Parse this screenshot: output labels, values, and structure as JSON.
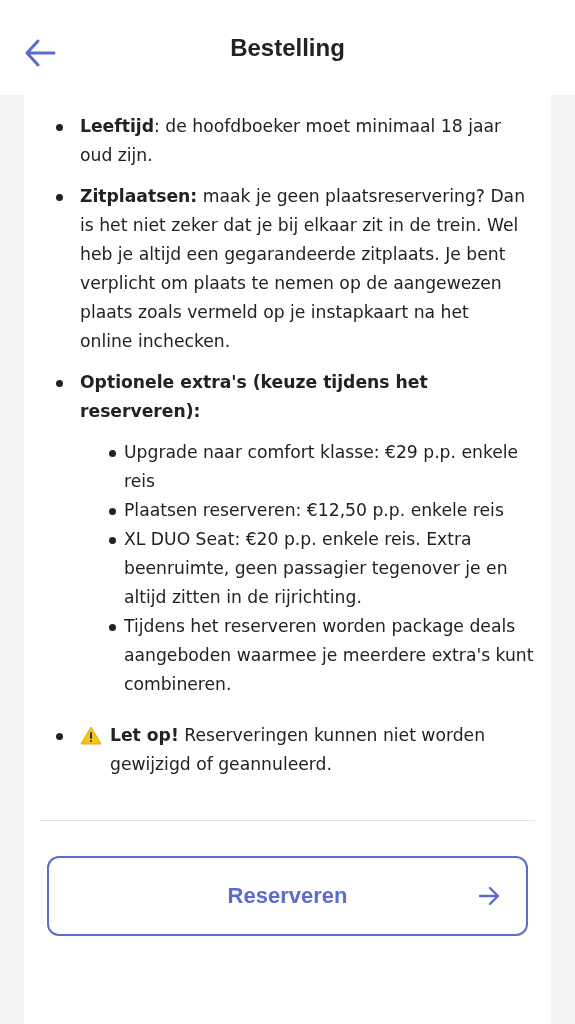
{
  "header": {
    "title": "Bestelling"
  },
  "items": [
    {
      "kind": "text",
      "text": "**Leeftijd**: de hoofdboeker moet minimaal 18 jaar oud zijn."
    },
    {
      "kind": "text",
      "text": "**Zitplaatsen:** maak je geen plaatsreservering? Dan is het niet zeker dat je bij elkaar zit in de trein. Wel heb je altijd een gegarandeerde zitplaats. Je bent verplicht om plaats te nemen op de aangewezen plaats zoals vermeld op je instapkaart na het online inchecken."
    },
    {
      "kind": "text",
      "text": "**Optionele extra's (keuze tijdens het reserveren):**",
      "children": [
        {
          "text": "Upgrade naar comfort klasse: €29 p.p. enkele reis"
        },
        {
          "text": "Plaatsen reserveren: €12,50 p.p. enkele reis"
        },
        {
          "text": "XL DUO Seat: €20 p.p. enkele reis. Extra beenruimte, geen passagier tegenover je en altijd zitten in de rijrichting."
        },
        {
          "text": "Tijdens het reserveren worden package deals aangeboden waarmee je meerdere extra's kunt combineren."
        }
      ]
    },
    {
      "kind": "warning",
      "text": "**Let op!** Reserveringen kunnen niet worden gewijzigd of geannuleerd."
    }
  ],
  "button": {
    "label": "Reserveren"
  }
}
